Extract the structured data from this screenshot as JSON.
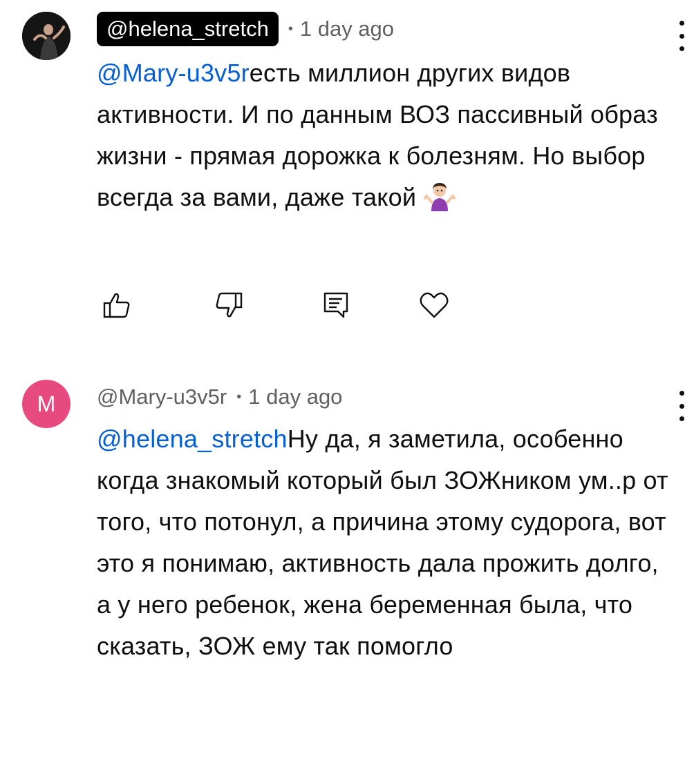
{
  "comments": [
    {
      "author_handle": "@helena_stretch",
      "author_highlighted": true,
      "time": "1 day ago",
      "separator": "•",
      "mention": "@Mary-u3v5r",
      "text": "есть миллион других видов активности. И по данным ВОЗ пассивный образ жизни - прямая дорожка к болезням. Но выбор всегда за вами, даже такой ",
      "emoji_icon": "woman-shrugging-icon",
      "actions": {
        "like_icon": "thumbs-up-icon",
        "dislike_icon": "thumbs-down-icon",
        "reply_icon": "reply-comment-icon",
        "heart_icon": "heart-icon"
      }
    },
    {
      "author_initial": "M",
      "author_handle": "@Mary-u3v5r",
      "avatar_color": "#e64a7e",
      "time": "1 day ago",
      "separator": "•",
      "mention": "@helena_stretch",
      "text": "Ну да, я заметила, особенно когда знакомый который был ЗОЖником ум..р от того, что потонул, а причина этому судорога, вот это я понимаю, активность дала прожить долго, а у него ребенок, жена беременная была, что сказать, ЗОЖ ему так помогло"
    }
  ],
  "colors": {
    "mention": "#065fd4",
    "meta_text": "#606060",
    "body_text": "#0f0f0f",
    "chip_bg": "#000000"
  }
}
